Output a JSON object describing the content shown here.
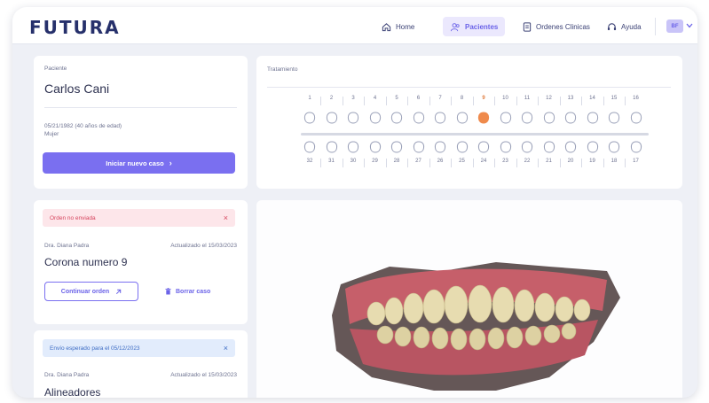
{
  "app": {
    "logo": "FUTURA"
  },
  "nav": {
    "home": "Home",
    "patients": "Pacientes",
    "clinical_orders": "Ordenes Clinicas",
    "help": "Ayuda",
    "avatar": "BF"
  },
  "patient": {
    "section_label": "Paciente",
    "name": "Carlos Cani",
    "dob": "05/21/1982 (40 años de edad)",
    "sex": "Mujer",
    "new_case_button": "Iniciar nuevo caso"
  },
  "treatment": {
    "label": "Tratamiento",
    "upper": [
      "1",
      "2",
      "3",
      "4",
      "5",
      "6",
      "7",
      "8",
      "9",
      "10",
      "11",
      "12",
      "13",
      "14",
      "15",
      "16"
    ],
    "lower": [
      "32",
      "31",
      "30",
      "29",
      "28",
      "27",
      "26",
      "25",
      "24",
      "23",
      "22",
      "21",
      "20",
      "19",
      "18",
      "17"
    ],
    "selected_tooth": "9",
    "selected_color": "#ef8a4c"
  },
  "orders": [
    {
      "status": "Orden no enviada",
      "status_type": "error",
      "doctor": "Dra. Diana Padra",
      "updated": "Actualizado el 15/03/2023",
      "title": "Corona numero 9",
      "continue_label": "Continuar orden",
      "delete_label": "Borrar caso"
    },
    {
      "status": "Envío esperado para el 05/12/2023",
      "status_type": "info",
      "doctor": "Dra. Diana Padra",
      "updated": "Actualizado el 15/03/2023",
      "title": "Alineadores"
    }
  ],
  "colors": {
    "accent": "#7a6ff0",
    "brand": "#26306b",
    "background": "#eef0f6"
  }
}
